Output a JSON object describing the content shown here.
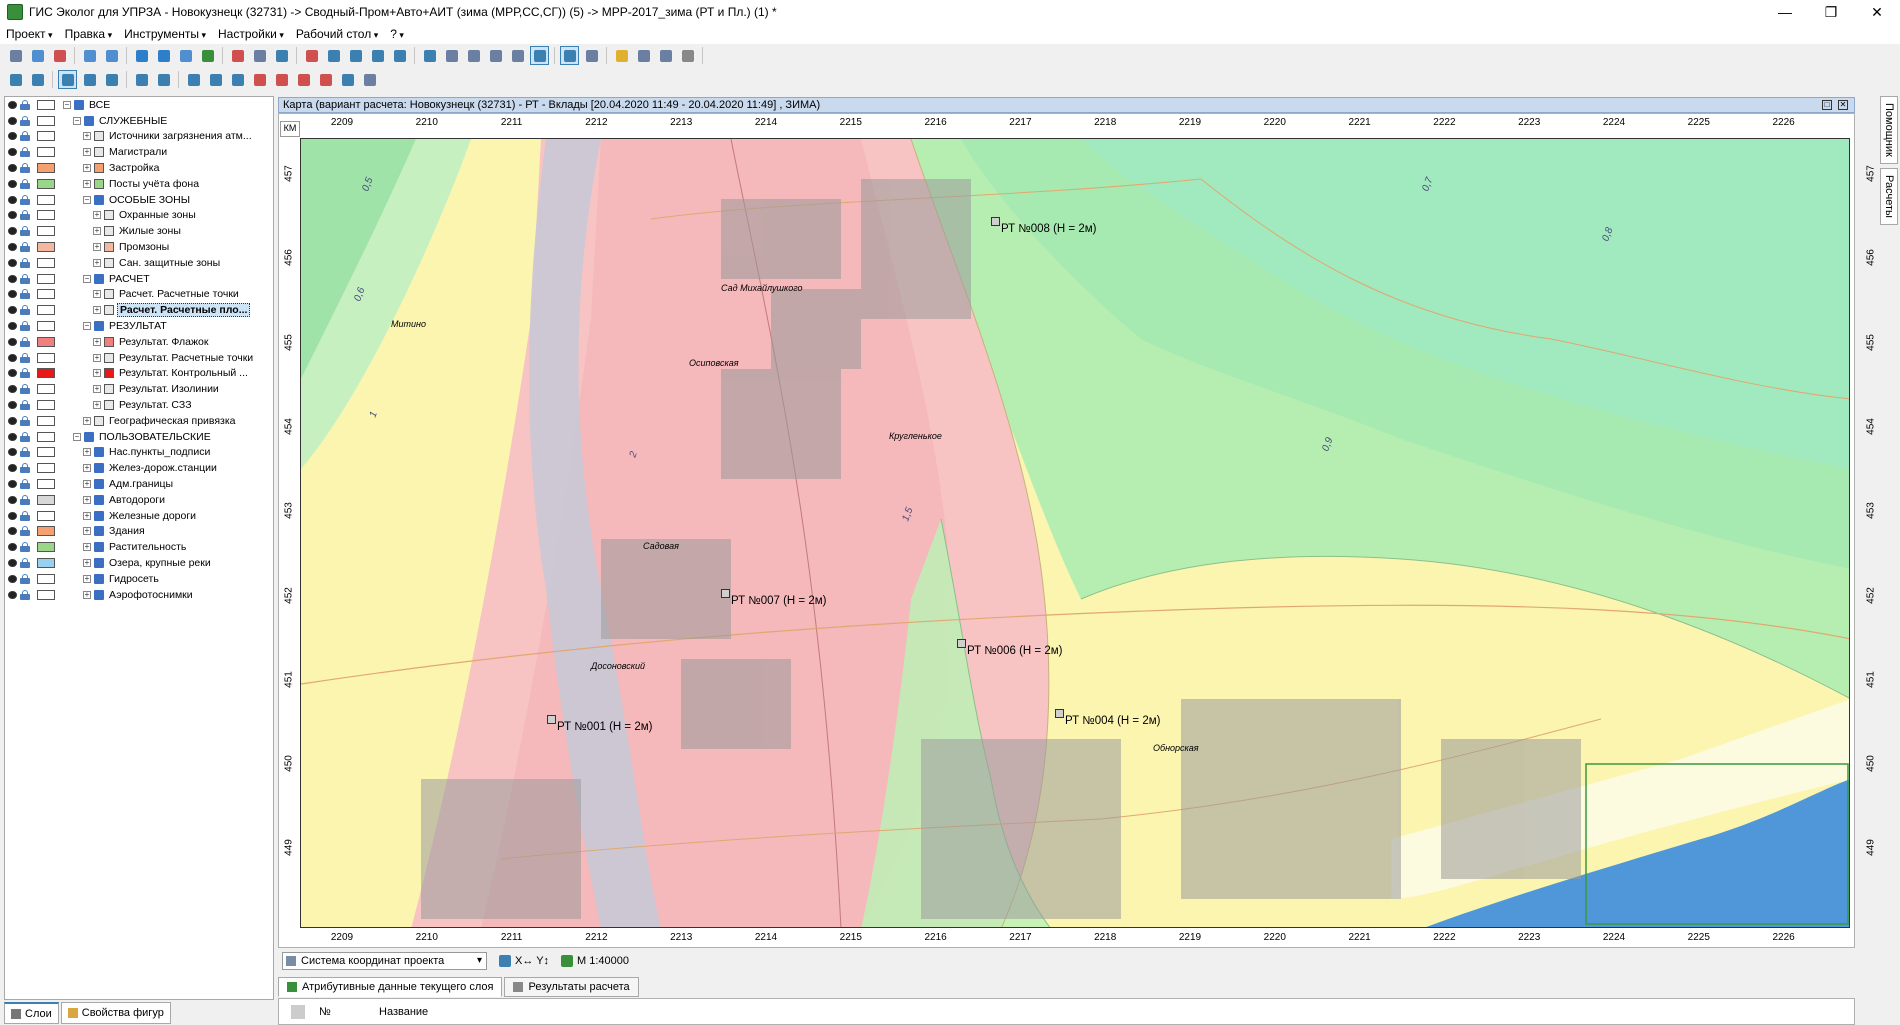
{
  "window": {
    "title": "ГИС Эколог для УПРЗА - Новокузнецк (32731) -> Сводный-Пром+Авто+АИТ (зима (МРР,СС,СГ)) (5) -> МРР-2017_зима (РТ и Пл.) (1) *",
    "minimize": "—",
    "maximize": "❐",
    "close": "✕"
  },
  "menu": [
    "Проект",
    "Правка",
    "Инструменты",
    "Настройки",
    "Рабочий стол",
    "?"
  ],
  "layers": [
    {
      "label": "ВСЕ",
      "level": 0,
      "type": "folder",
      "swatch": "#ffffff",
      "eye": true,
      "expand": "-"
    },
    {
      "label": "СЛУЖЕБНЫЕ",
      "level": 1,
      "type": "folder",
      "swatch": "#ffffff",
      "eye": true,
      "expand": "-"
    },
    {
      "label": "Источники загрязнения атм...",
      "level": 2,
      "type": "source",
      "swatch": "#ffffff",
      "eye": true,
      "expand": "+"
    },
    {
      "label": "Магистрали",
      "level": 2,
      "type": "road",
      "swatch": "#ffffff",
      "eye": true,
      "expand": "+"
    },
    {
      "label": "Застройка",
      "level": 2,
      "type": "build",
      "swatch": "#f4a070",
      "eye": true,
      "expand": "+"
    },
    {
      "label": "Посты учёта фона",
      "level": 2,
      "type": "post",
      "swatch": "#9bd58a",
      "eye": true,
      "expand": "+"
    },
    {
      "label": "ОСОБЫЕ ЗОНЫ",
      "level": 2,
      "type": "folder",
      "swatch": "#ffffff",
      "eye": true,
      "expand": "-"
    },
    {
      "label": "Охранные зоны",
      "level": 3,
      "type": "zone-green",
      "swatch": "#ffffff",
      "eye": true,
      "expand": "+"
    },
    {
      "label": "Жилые зоны",
      "level": 3,
      "type": "zone-yellow",
      "swatch": "#ffffff",
      "eye": true,
      "expand": "+"
    },
    {
      "label": "Промзоны",
      "level": 3,
      "type": "zone-orange",
      "swatch": "#f4b8a0",
      "eye": true,
      "expand": "+"
    },
    {
      "label": "Сан. защитные зоны",
      "level": 3,
      "type": "zone-blue",
      "swatch": "#ffffff",
      "eye": true,
      "expand": "+"
    },
    {
      "label": "РАСЧЕТ",
      "level": 2,
      "type": "folder",
      "swatch": "#ffffff",
      "eye": true,
      "expand": "-"
    },
    {
      "label": "Расчет. Расчетные точки",
      "level": 3,
      "type": "calc-points",
      "swatch": "#ffffff",
      "eye": true,
      "expand": "+"
    },
    {
      "label": "Расчет. Расчетные пло...",
      "level": 3,
      "type": "calc-areas",
      "swatch": "#ffffff",
      "eye": true,
      "expand": "+",
      "selected": true
    },
    {
      "label": "РЕЗУЛЬТАТ",
      "level": 2,
      "type": "folder",
      "swatch": "#ffffff",
      "eye": true,
      "expand": "-"
    },
    {
      "label": "Результат. Флажок",
      "level": 3,
      "type": "flag",
      "swatch": "#f08080",
      "eye": true,
      "expand": "+"
    },
    {
      "label": "Результат. Расчетные точки",
      "level": 3,
      "type": "res-points",
      "swatch": "#ffffff",
      "eye": true,
      "expand": "+"
    },
    {
      "label": "Результат. Контрольный ...",
      "level": 3,
      "type": "control",
      "swatch": "#e81818",
      "eye": true,
      "expand": "+"
    },
    {
      "label": "Результат. Изолинии",
      "level": 3,
      "type": "isolines",
      "swatch": "#ffffff",
      "eye": true,
      "expand": "+"
    },
    {
      "label": "Результат. СЗЗ",
      "level": 3,
      "type": "szz",
      "swatch": "#ffffff",
      "eye": true,
      "expand": "+"
    },
    {
      "label": "Географическая привязка",
      "level": 2,
      "type": "geo",
      "swatch": "#ffffff",
      "eye": true,
      "expand": "+"
    },
    {
      "label": "ПОЛЬЗОВАТЕЛЬСКИЕ",
      "level": 1,
      "type": "folder",
      "swatch": "#ffffff",
      "eye": true,
      "expand": "-"
    },
    {
      "label": "Нас.пункты_подписи",
      "level": 2,
      "type": "folder",
      "swatch": "#ffffff",
      "eye": true,
      "expand": "+"
    },
    {
      "label": "Желез-дорож.станции",
      "level": 2,
      "type": "folder",
      "swatch": "#ffffff",
      "eye": true,
      "expand": "+"
    },
    {
      "label": "Адм.границы",
      "level": 2,
      "type": "folder",
      "swatch": "#ffffff",
      "eye": true,
      "expand": "+"
    },
    {
      "label": "Автодороги",
      "level": 2,
      "type": "folder",
      "swatch": "#d8d8d8",
      "eye": true,
      "expand": "+"
    },
    {
      "label": "Железные дороги",
      "level": 2,
      "type": "folder",
      "swatch": "#ffffff",
      "eye": true,
      "expand": "+"
    },
    {
      "label": "Здания",
      "level": 2,
      "type": "folder",
      "swatch": "#f4a070",
      "eye": true,
      "expand": "+"
    },
    {
      "label": "Растительность",
      "level": 2,
      "type": "folder",
      "swatch": "#9bd58a",
      "eye": true,
      "expand": "+"
    },
    {
      "label": "Озера, крупные реки",
      "level": 2,
      "type": "folder",
      "swatch": "#9ad0ef",
      "eye": true,
      "expand": "+"
    },
    {
      "label": "Гидросеть",
      "level": 2,
      "type": "folder",
      "swatch": "#ffffff",
      "eye": true,
      "expand": "+"
    },
    {
      "label": "Аэрофотоснимки",
      "level": 2,
      "type": "folder",
      "swatch": "#ffffff",
      "eye": true,
      "expand": "+"
    }
  ],
  "panel_tabs": [
    "Слои",
    "Свойства фигур"
  ],
  "map": {
    "header": "Карта (вариант расчета: Новокузнецк (32731) - РТ - Вклады [20.04.2020 11:49 - 20.04.2020 11:49] , ЗИМА)",
    "km_label": "КМ",
    "x_ticks": [
      "2209",
      "2210",
      "2211",
      "2212",
      "2213",
      "2214",
      "2215",
      "2216",
      "2217",
      "2218",
      "2219",
      "2220",
      "2221",
      "2222",
      "2223",
      "2224",
      "2225",
      "2226"
    ],
    "y_ticks": [
      "457",
      "456",
      "455",
      "454",
      "453",
      "452",
      "451",
      "450",
      "449"
    ],
    "places": [
      "Митино",
      "Сад Михайлушкого",
      "Осиповская",
      "Кругленькое",
      "Садовая",
      "Досоновский",
      "Обнорская"
    ],
    "rt_points": [
      "РТ №008 (H = 2м)",
      "РТ №007 (H = 2м)",
      "РТ №006 (H = 2м)",
      "РТ №004 (H = 2м)",
      "РТ №001 (H = 2м)"
    ],
    "iso_values": [
      "0,5",
      "0,6",
      "0,7",
      "0,8",
      "0,9",
      "1",
      "1,5",
      "2"
    ],
    "colors": {
      "red": "#f7c8c8",
      "yellow": "#fbf5b0",
      "green": "#a8ebb0",
      "green_light": "#c6f2c2",
      "blue_water": "#4f97d8"
    }
  },
  "status": {
    "coord_system": "Система координат проекта",
    "xy": "X↔ Y↕",
    "scale": "М 1:40000"
  },
  "bottom_tabs": [
    "Атрибутивные данные текущего слоя",
    "Результаты расчета"
  ],
  "attr_columns": [
    "№",
    "Название"
  ],
  "right_rail": [
    "Помощник",
    "Расчеты"
  ]
}
